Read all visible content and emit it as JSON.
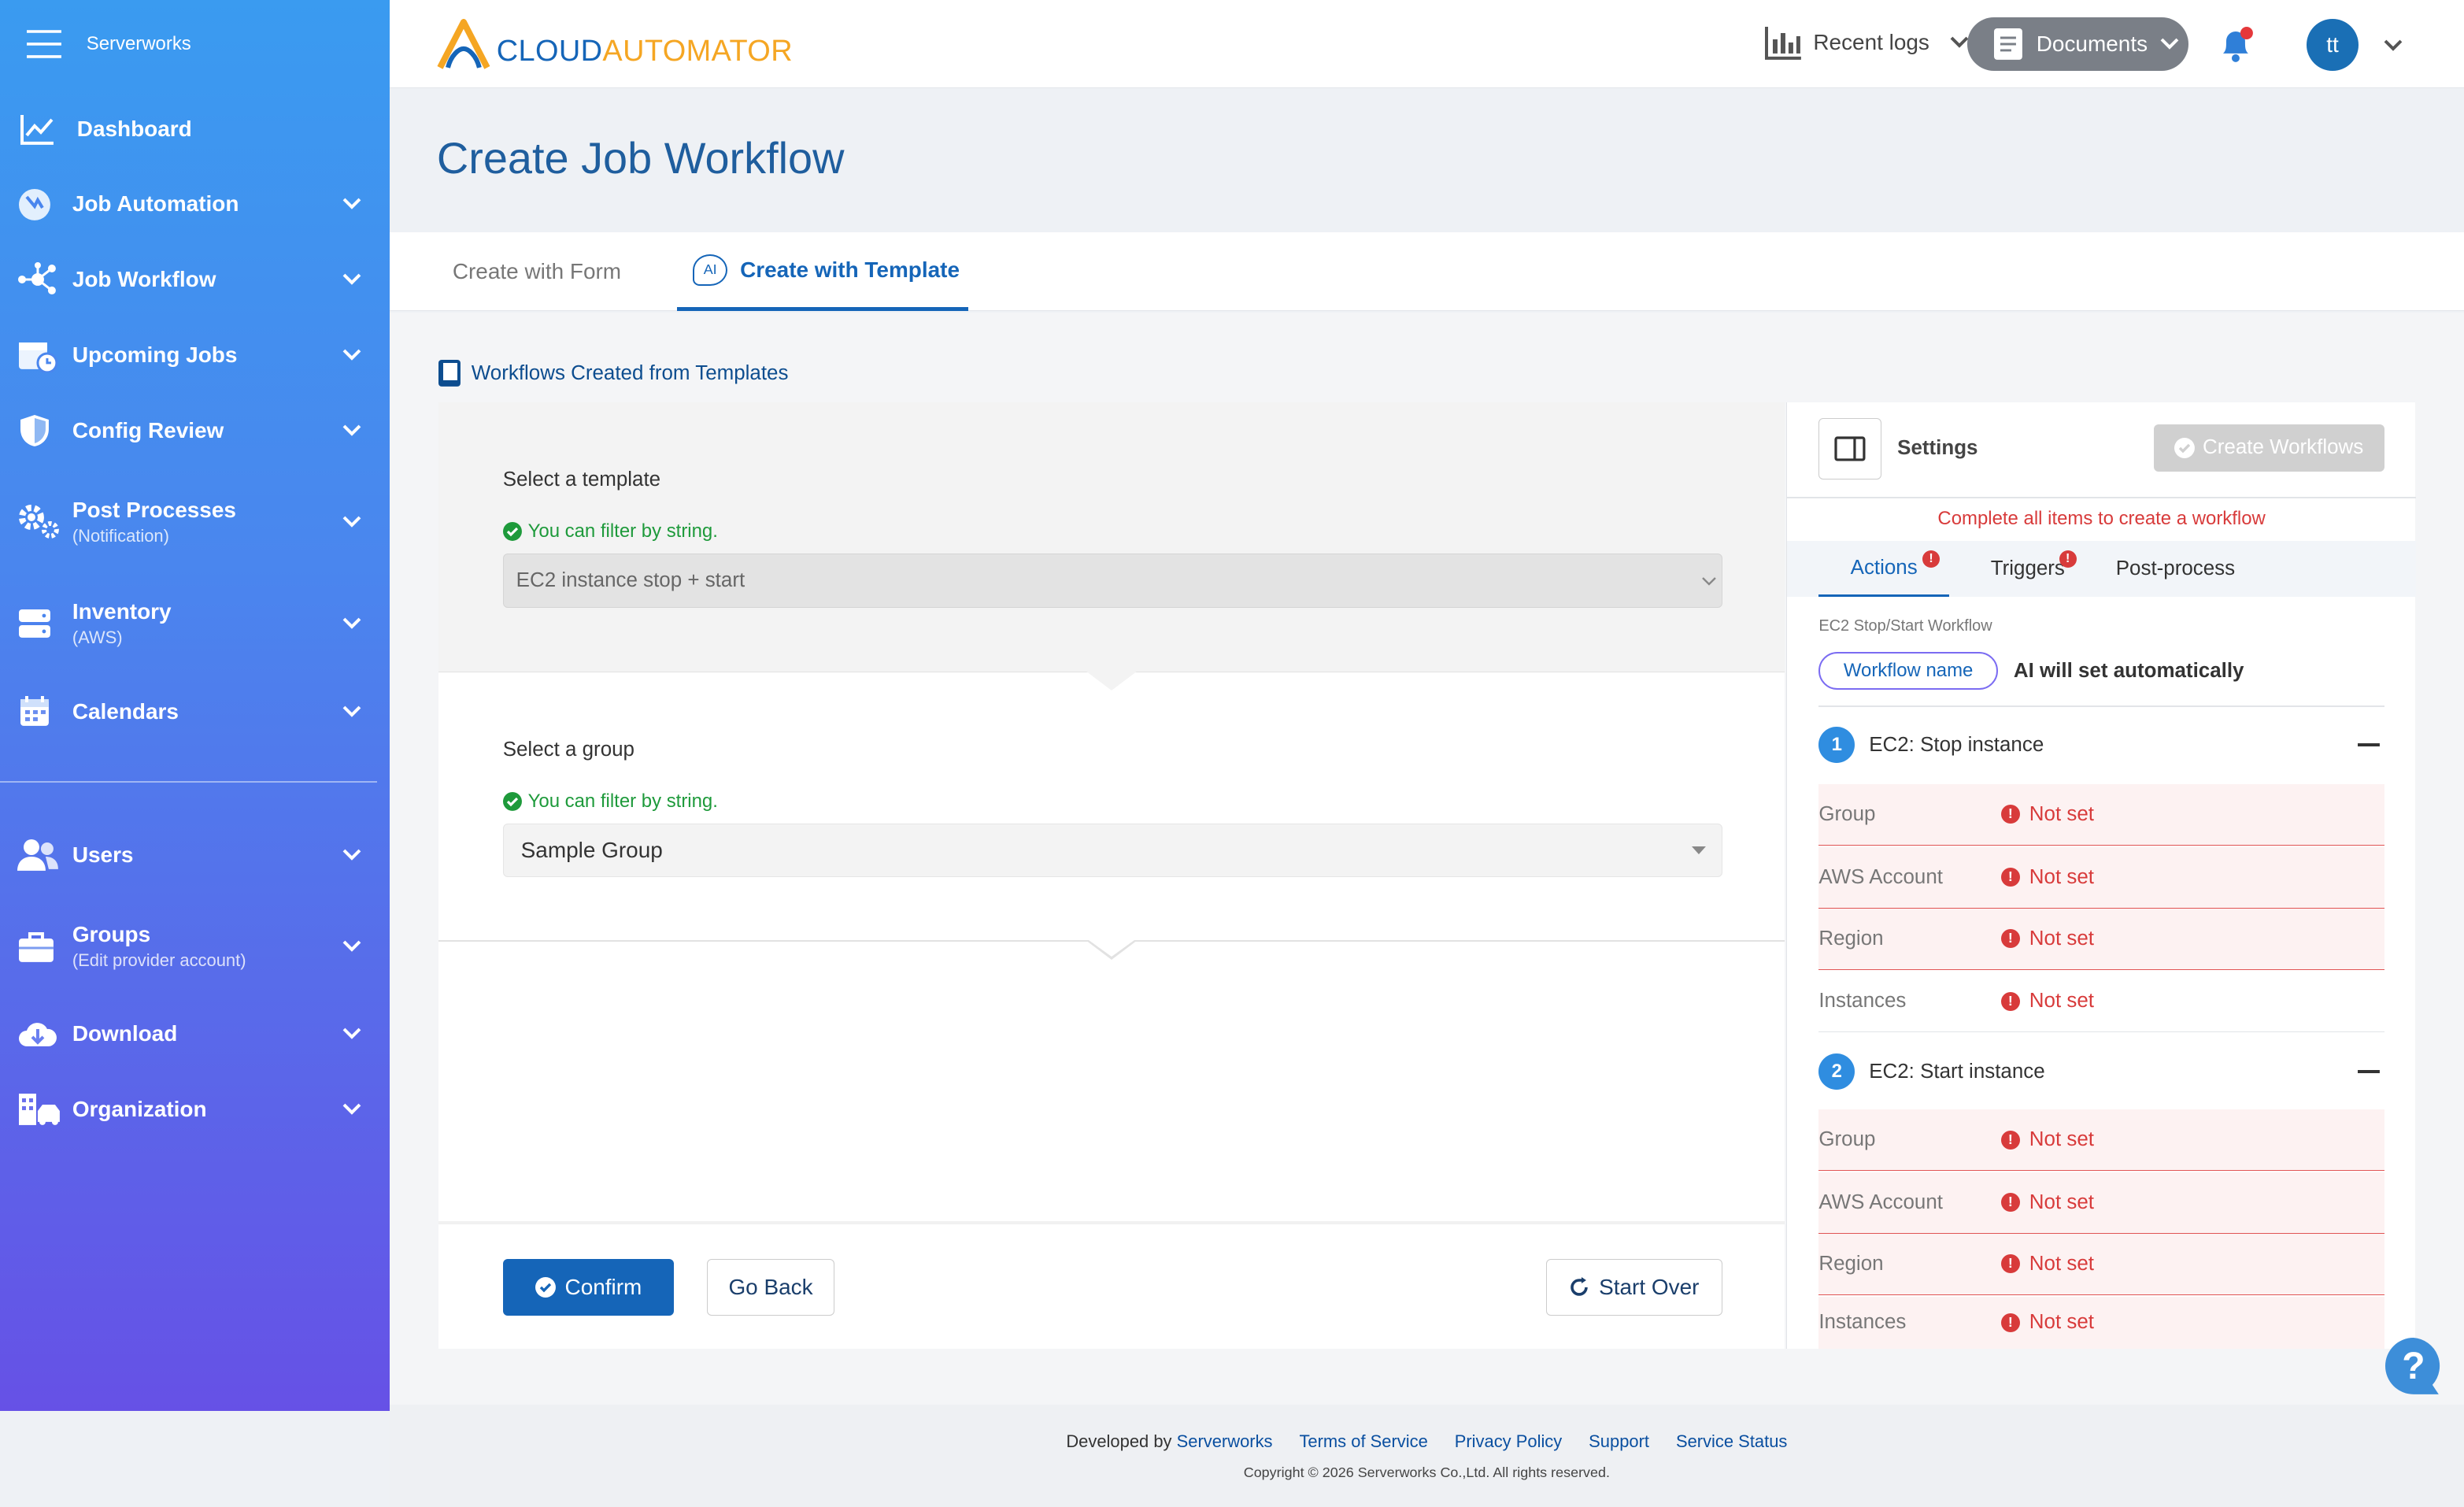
{
  "brand": {
    "org_name": "Serverworks",
    "logo_text_a": "CLOUD",
    "logo_text_b": "AUTOMATOR"
  },
  "sidebar": {
    "items": [
      {
        "label": "Dashboard",
        "icon": "chart-line-icon"
      },
      {
        "label": "Job Automation",
        "icon": "globe-icon"
      },
      {
        "label": "Job Workflow",
        "icon": "workflow-nodes-icon"
      },
      {
        "label": "Upcoming Jobs",
        "icon": "calendar-clock-icon"
      },
      {
        "label": "Config Review",
        "icon": "shield-icon"
      },
      {
        "label": "Post Processes",
        "sub": "(Notification)",
        "icon": "gears-icon"
      },
      {
        "label": "Inventory",
        "sub": "(AWS)",
        "icon": "server-icon"
      },
      {
        "label": "Calendars",
        "icon": "calendar-icon"
      },
      {
        "label": "Users",
        "icon": "users-icon"
      },
      {
        "label": "Groups",
        "sub": "(Edit provider account)",
        "icon": "briefcase-icon"
      },
      {
        "label": "Download",
        "icon": "cloud-download-icon"
      },
      {
        "label": "Organization",
        "icon": "building-icon"
      }
    ]
  },
  "header": {
    "recent_logs": "Recent logs",
    "documents": "Documents",
    "avatar": "tt"
  },
  "page": {
    "title": "Create Job Workflow"
  },
  "tabs": [
    {
      "label": "Create with Form"
    },
    {
      "label": "Create with Template",
      "badge": "AI"
    }
  ],
  "section": {
    "title": "Workflows Created from Templates"
  },
  "form": {
    "template_label": "Select a template",
    "filter_hint": "You can filter by string.",
    "template_value": "EC2 instance stop + start",
    "group_label": "Select a group",
    "group_value": "Sample Group"
  },
  "buttons": {
    "confirm": "Confirm",
    "go_back": "Go Back",
    "start_over": "Start Over"
  },
  "settings": {
    "title": "Settings",
    "create_btn": "Create Workflows",
    "warning": "Complete all items to create a workflow",
    "tabs": [
      "Actions",
      "Triggers",
      "Post-process"
    ],
    "workflow_caption": "EC2 Stop/Start Workflow",
    "workflow_name_label": "Workflow name",
    "workflow_name_value": "AI will set automatically",
    "not_set": "Not set",
    "steps": [
      {
        "num": "1",
        "title": "EC2: Stop instance",
        "fields": [
          "Group",
          "AWS Account",
          "Region",
          "Instances"
        ]
      },
      {
        "num": "2",
        "title": "EC2: Start instance",
        "fields": [
          "Group",
          "AWS Account",
          "Region",
          "Instances"
        ]
      }
    ]
  },
  "footer": {
    "developed_by": "Developed by",
    "developer": "Serverworks",
    "links": [
      "Terms of Service",
      "Privacy Policy",
      "Support",
      "Service Status"
    ],
    "copyright": "Copyright © 2026 Serverworks Co.,Ltd. All rights reserved."
  },
  "colors": {
    "primary": "#1565b8",
    "accent": "#f5a623",
    "danger": "#d83b3b",
    "sidebar_top": "#3a9bf0",
    "sidebar_bottom": "#6651e6"
  }
}
